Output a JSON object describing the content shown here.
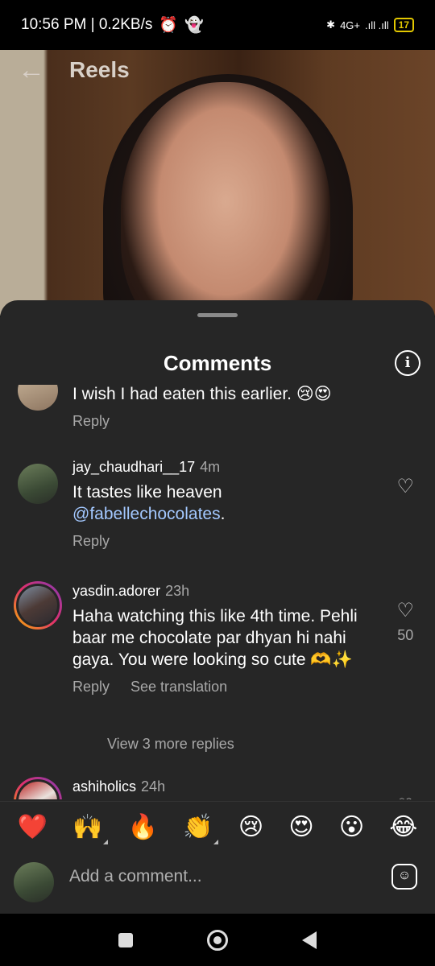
{
  "status_bar": {
    "time_speed": "10:56 PM | 0.2KB/s",
    "alarm_icon": "⏰",
    "snap_icon": "👻",
    "bluetooth_icon": "✱",
    "network": "4G+",
    "signal": ".ıll .ıll",
    "battery": "17"
  },
  "reels_header": {
    "back_icon": "←",
    "title": "Reels"
  },
  "comments_sheet": {
    "title": "Comments",
    "info_icon": "i",
    "comments": [
      {
        "text": "I wish I had eaten this earlier. 😢😍",
        "reply_label": "Reply"
      },
      {
        "username": "jay_chaudhari__17",
        "time": "4m",
        "text": "It tastes like heaven ",
        "mention": "@fabellechocolates",
        "text_suffix": ".",
        "reply_label": "Reply",
        "heart_icon": "♡"
      },
      {
        "username": "yasdin.adorer",
        "time": "23h",
        "text": "Haha watching this like 4th time. Pehli baar me chocolate par dhyan hi nahi gaya. You were looking so cute 🫶✨",
        "reply_label": "Reply",
        "translate_label": "See translation",
        "heart_icon": "♡",
        "likes": "50",
        "view_replies": "View 3 more replies"
      },
      {
        "username": "ashiholics",
        "time": "24h",
        "heart_icon": "♡"
      }
    ]
  },
  "emoji_bar": [
    "❤️",
    "🙌",
    "🔥",
    "👏",
    "😢",
    "😍",
    "😮",
    "😂"
  ],
  "input_bar": {
    "placeholder": "Add a comment...",
    "sticker_icon": "☺"
  }
}
